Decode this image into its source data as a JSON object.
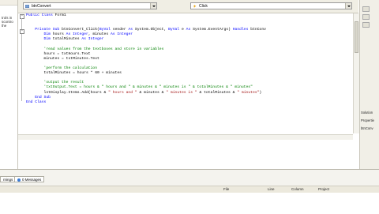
{
  "left_panel": {
    "text": "trols in\nscontro\nthe"
  },
  "toolbar": {
    "object_dropdown": "btnConvert",
    "event_dropdown": "Click"
  },
  "code": {
    "lines": [
      [
        [
          "kw",
          "Public Class "
        ],
        [
          "tx",
          "Form1"
        ]
      ],
      [
        [
          "tx",
          ""
        ]
      ],
      [
        [
          "tx",
          ""
        ]
      ],
      [
        [
          "tx",
          "    "
        ],
        [
          "kw",
          "Private Sub "
        ],
        [
          "tx",
          "btnConvert_Click("
        ],
        [
          "kw",
          "ByVal "
        ],
        [
          "tx",
          "sender "
        ],
        [
          "kw",
          "As "
        ],
        [
          "tx",
          "System.Object, "
        ],
        [
          "kw",
          "ByVal "
        ],
        [
          "tx",
          "e "
        ],
        [
          "kw",
          "As "
        ],
        [
          "tx",
          "System.EventArgs) "
        ],
        [
          "kw",
          "Handles "
        ],
        [
          "tx",
          "btnConv"
        ]
      ],
      [
        [
          "tx",
          "        "
        ],
        [
          "kw",
          "Dim "
        ],
        [
          "tx",
          "hours "
        ],
        [
          "kw",
          "As Integer"
        ],
        [
          "tx",
          ", minutes "
        ],
        [
          "kw",
          "As Integer"
        ]
      ],
      [
        [
          "tx",
          "        "
        ],
        [
          "kw",
          "Dim "
        ],
        [
          "tx",
          "totalMinutes "
        ],
        [
          "kw",
          "As Integer"
        ]
      ],
      [
        [
          "tx",
          ""
        ]
      ],
      [
        [
          "tx",
          "        "
        ],
        [
          "cm",
          "'read values from the textboxes and store in variables"
        ]
      ],
      [
        [
          "tx",
          "        hours = txtHours.Text"
        ]
      ],
      [
        [
          "tx",
          "        minutes = txtMinutes.Text"
        ]
      ],
      [
        [
          "tx",
          ""
        ]
      ],
      [
        [
          "tx",
          "        "
        ],
        [
          "cm",
          "'perform the calculation"
        ]
      ],
      [
        [
          "tx",
          "        totalMinutes = hours * 60 + minutes"
        ]
      ],
      [
        [
          "tx",
          ""
        ]
      ],
      [
        [
          "tx",
          "        "
        ],
        [
          "cm",
          "'output the result"
        ]
      ],
      [
        [
          "tx",
          "        "
        ],
        [
          "cm",
          "'txtOutput.Text = hours & \" hours and \" & minutes & \" minutes is \" & totalMinutes & \" minutes\""
        ]
      ],
      [
        [
          "tx",
          "        lstDisplay.Items.Add(hours & "
        ],
        [
          "st",
          "\" hours and \""
        ],
        [
          "tx",
          " & minutes & "
        ],
        [
          "st",
          "\" minutes is \""
        ],
        [
          "tx",
          " & totalMinutes & "
        ],
        [
          "st",
          "\" minutes\""
        ],
        [
          "tx",
          ")"
        ]
      ],
      [
        [
          "tx",
          "    "
        ],
        [
          "kw",
          "End Sub"
        ]
      ],
      [
        [
          "kw",
          "End Class"
        ]
      ]
    ]
  },
  "right_panel": {
    "labels": [
      "Solution",
      "Propertie",
      "btnConv"
    ]
  },
  "bottom_panel": {
    "tab_warnings": "rnings",
    "tab_messages": "0 Messages",
    "columns": [
      "File",
      "Line",
      "Column",
      "Project"
    ]
  },
  "colors": {
    "keyword": "#0000ff",
    "comment": "#008000",
    "string": "#a31515"
  }
}
